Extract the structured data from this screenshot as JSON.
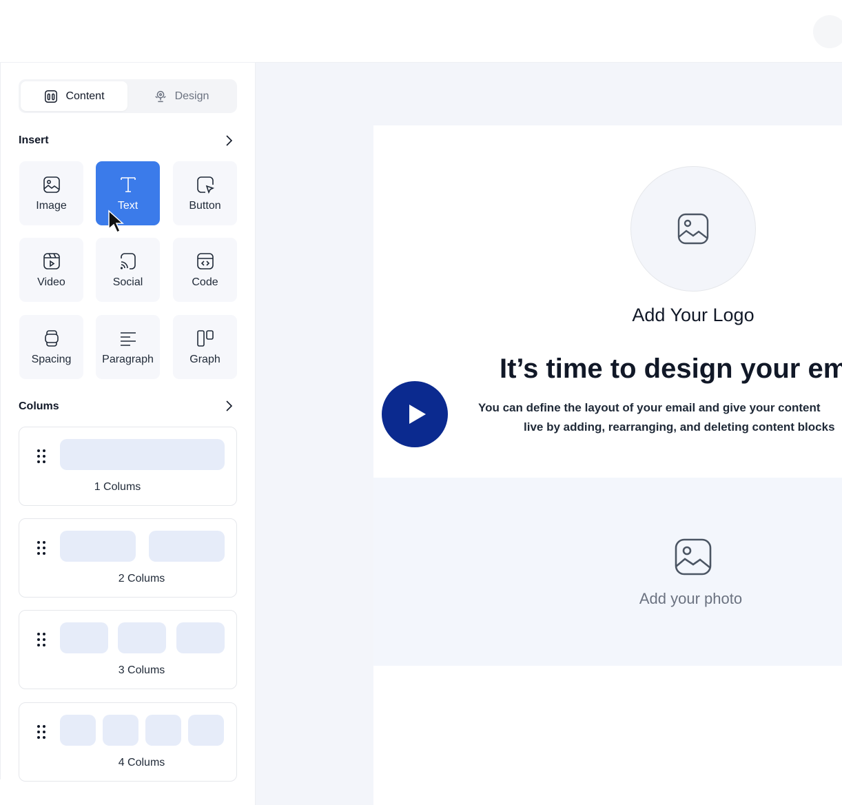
{
  "tabs": {
    "content_label": "Content",
    "design_label": "Design"
  },
  "insert": {
    "title": "Insert",
    "items": [
      {
        "label": "Image",
        "icon": "image-icon"
      },
      {
        "label": "Text",
        "icon": "text-icon",
        "active": true
      },
      {
        "label": "Button",
        "icon": "button-icon"
      },
      {
        "label": "Video",
        "icon": "video-icon"
      },
      {
        "label": "Social",
        "icon": "social-icon"
      },
      {
        "label": "Code",
        "icon": "code-icon"
      },
      {
        "label": "Spacing",
        "icon": "spacing-icon"
      },
      {
        "label": "Paragraph",
        "icon": "paragraph-icon"
      },
      {
        "label": "Graph",
        "icon": "graph-icon"
      }
    ]
  },
  "columns": {
    "title": "Colums",
    "items": [
      {
        "label": "1 Colums",
        "count": 1
      },
      {
        "label": "2 Colums",
        "count": 2
      },
      {
        "label": "3 Colums",
        "count": 3
      },
      {
        "label": "4 Colums",
        "count": 4
      }
    ]
  },
  "canvas": {
    "logo_label": "Add Your Logo",
    "headline": "It’s time to design your email",
    "desc_line1": "You can define the layout of your email and give your content",
    "desc_line2": "live by adding, rearranging, and deleting content blocks",
    "photo_label": "Add your photo"
  },
  "colors": {
    "accent": "#3b7bea",
    "play_button": "#0b2a8f",
    "pill": "#e6ecf9",
    "canvas_bg": "#f3f5fa"
  }
}
